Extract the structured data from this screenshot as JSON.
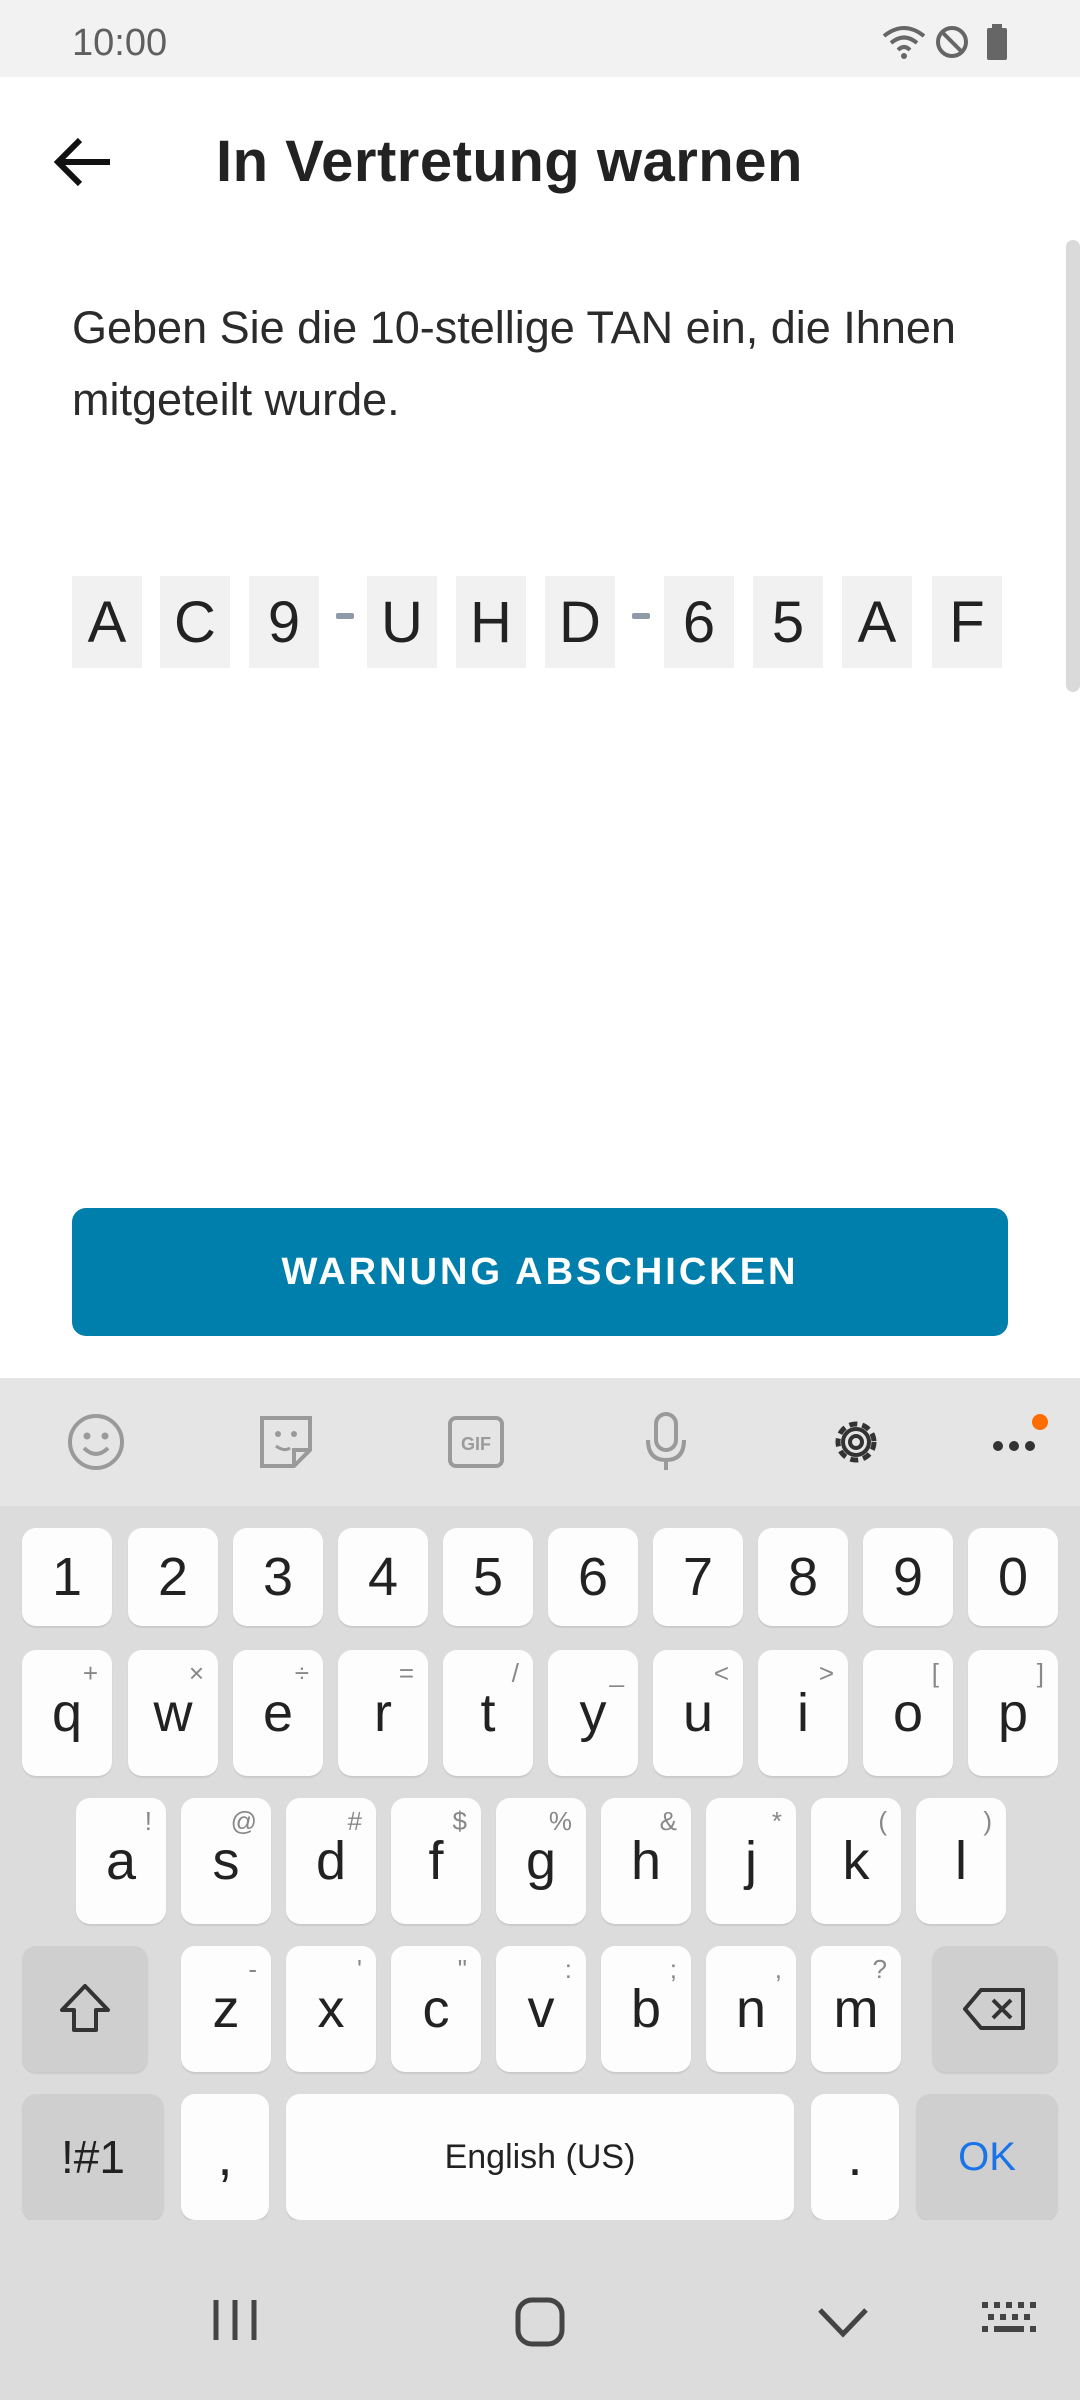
{
  "status": {
    "time": "10:00"
  },
  "header": {
    "title": "In Vertretung warnen"
  },
  "instruction": "Geben Sie die 10-stellige TAN ein, die Ihnen mitgeteilt wurde.",
  "tan": [
    "A",
    "C",
    "9",
    "U",
    "H",
    "D",
    "6",
    "5",
    "A",
    "F"
  ],
  "button": {
    "label": "WARNUNG ABSCHICKEN"
  },
  "keyboard": {
    "numbers": [
      "1",
      "2",
      "3",
      "4",
      "5",
      "6",
      "7",
      "8",
      "9",
      "0"
    ],
    "row1": [
      {
        "k": "q",
        "h": "+"
      },
      {
        "k": "w",
        "h": "×"
      },
      {
        "k": "e",
        "h": "÷"
      },
      {
        "k": "r",
        "h": "="
      },
      {
        "k": "t",
        "h": "/"
      },
      {
        "k": "y",
        "h": "_"
      },
      {
        "k": "u",
        "h": "<"
      },
      {
        "k": "i",
        "h": ">"
      },
      {
        "k": "o",
        "h": "["
      },
      {
        "k": "p",
        "h": "]"
      }
    ],
    "row2": [
      {
        "k": "a",
        "h": "!"
      },
      {
        "k": "s",
        "h": "@"
      },
      {
        "k": "d",
        "h": "#"
      },
      {
        "k": "f",
        "h": "$"
      },
      {
        "k": "g",
        "h": "%"
      },
      {
        "k": "h",
        "h": "&"
      },
      {
        "k": "j",
        "h": "*"
      },
      {
        "k": "k",
        "h": "("
      },
      {
        "k": "l",
        "h": ")"
      }
    ],
    "row3": [
      {
        "k": "z",
        "h": "-"
      },
      {
        "k": "x",
        "h": "'"
      },
      {
        "k": "c",
        "h": "\""
      },
      {
        "k": "v",
        "h": ":"
      },
      {
        "k": "b",
        "h": ";"
      },
      {
        "k": "n",
        "h": ","
      },
      {
        "k": "m",
        "h": "?"
      }
    ],
    "symbols_label": "!#1",
    "comma": ",",
    "space_label": "English (US)",
    "period": ".",
    "ok_label": "OK"
  },
  "colors": {
    "primary": "#007fad",
    "ok_text": "#1a73e8",
    "notification_dot": "#ff6d00"
  }
}
